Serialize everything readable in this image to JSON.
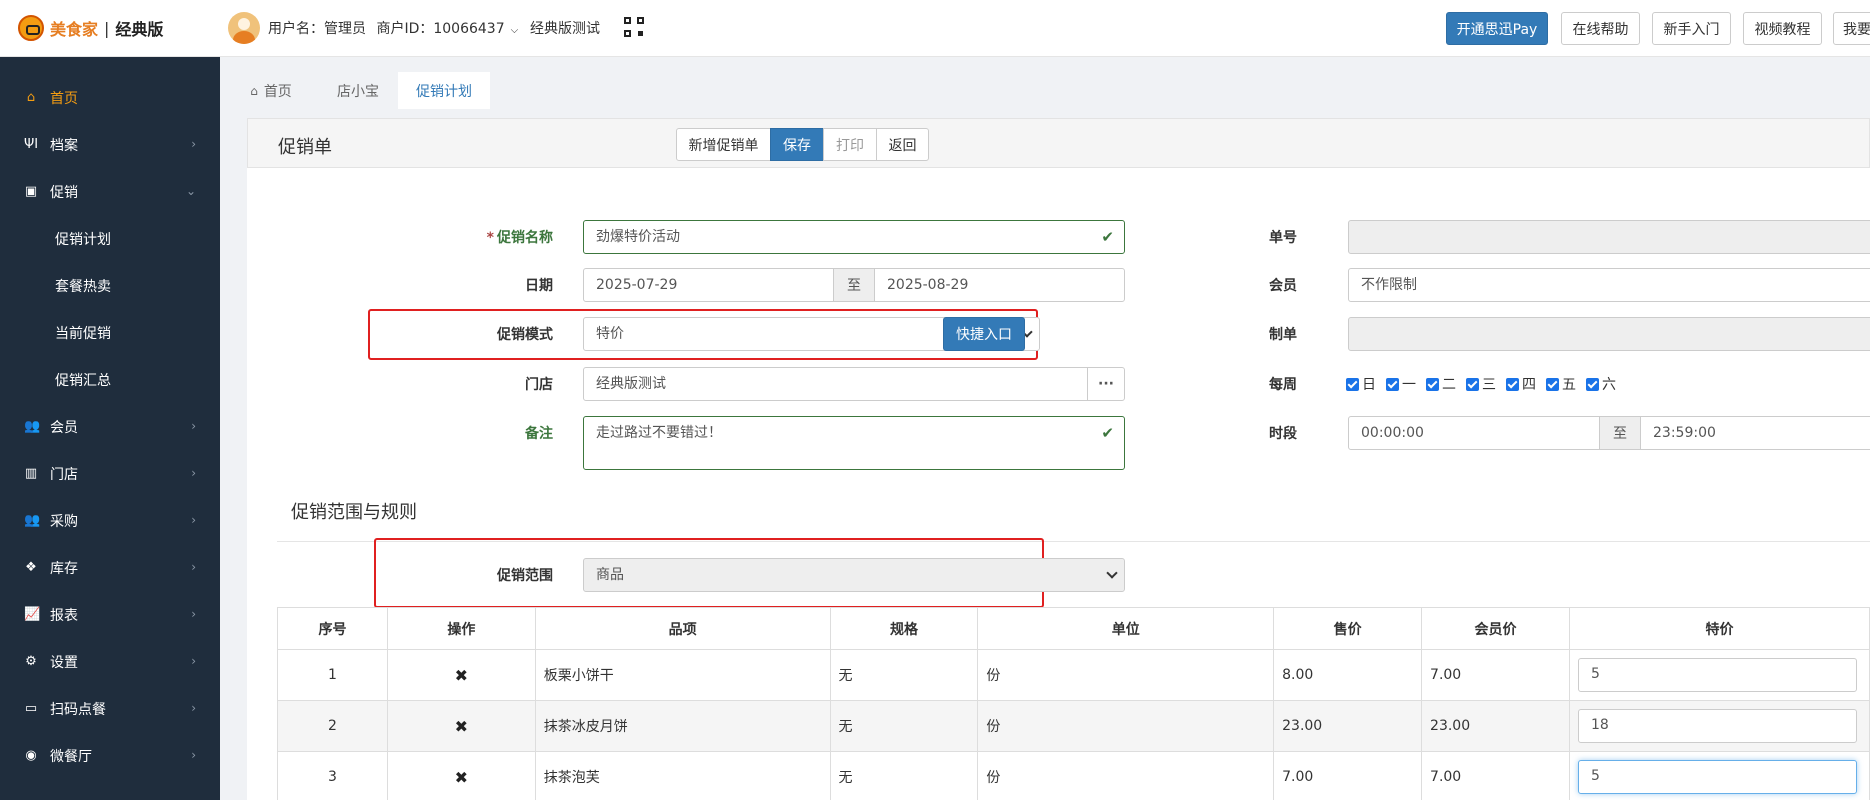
{
  "header": {
    "brand": "美食家",
    "separator": "|",
    "edition": "经典版",
    "username_label": "用户名：管理员",
    "merchant_id": "商户ID：10066437",
    "store_name": "经典版测试",
    "buttons": [
      "开通思迅Pay",
      "在线帮助",
      "新手入门",
      "视频教程",
      "我要购"
    ]
  },
  "sidebar": {
    "items": [
      {
        "label": "首页",
        "icon": "home-icon"
      },
      {
        "label": "档案",
        "icon": "utensils-icon"
      },
      {
        "label": "促销",
        "icon": "gift-icon"
      },
      {
        "label": "促销计划"
      },
      {
        "label": "套餐热卖"
      },
      {
        "label": "当前促销"
      },
      {
        "label": "促销汇总"
      },
      {
        "label": "会员",
        "icon": "users-icon"
      },
      {
        "label": "门店",
        "icon": "bank-icon"
      },
      {
        "label": "采购",
        "icon": "users-icon"
      },
      {
        "label": "库存",
        "icon": "cubes-icon"
      },
      {
        "label": "报表",
        "icon": "chart-icon"
      },
      {
        "label": "设置",
        "icon": "gear-icon"
      },
      {
        "label": "扫码点餐",
        "icon": "laptop-icon"
      },
      {
        "label": "微餐厅",
        "icon": "compass-icon"
      }
    ]
  },
  "tabs": [
    "首页",
    "店小宝",
    "促销计划"
  ],
  "panel": {
    "title": "促销单",
    "actions": [
      "新增促销单",
      "保存",
      "打印",
      "返回"
    ]
  },
  "form": {
    "name_label": "促销名称",
    "name_value": "劲爆特价活动",
    "date_label": "日期",
    "date_start": "2025-07-29",
    "date_to": "至",
    "date_end": "2025-08-29",
    "mode_label": "促销模式",
    "mode_value": "特价",
    "quick_entry": "快捷入口",
    "store_label": "门店",
    "store_value": "经典版测试",
    "store_more": "···",
    "remark_label": "备注",
    "remark_value": "走过路过不要错过！",
    "order_no_label": "单号",
    "order_no_value": "",
    "member_label": "会员",
    "member_value": "不作限制",
    "maker_label": "制单",
    "maker_value": "",
    "weekly_label": "每周",
    "weekdays": [
      "日",
      "一",
      "二",
      "三",
      "四",
      "五",
      "六"
    ],
    "time_label": "时段",
    "time_start": "00:00:00",
    "time_to": "至",
    "time_end": "23:59:00"
  },
  "scope": {
    "section_title": "促销范围与规则",
    "scope_label": "促销范围",
    "scope_value": "商品"
  },
  "table": {
    "headers": [
      "序号",
      "操作",
      "品项",
      "规格",
      "单位",
      "售价",
      "会员价",
      "特价"
    ],
    "rows": [
      {
        "no": "1",
        "action": "✖",
        "item": "板栗小饼干",
        "spec": "无",
        "unit": "份",
        "price": "8.00",
        "member_price": "7.00",
        "special": "5"
      },
      {
        "no": "2",
        "action": "✖",
        "item": "抹茶冰皮月饼",
        "spec": "无",
        "unit": "份",
        "price": "23.00",
        "member_price": "23.00",
        "special": "18"
      },
      {
        "no": "3",
        "action": "✖",
        "item": "抹茶泡芙",
        "spec": "无",
        "unit": "份",
        "price": "7.00",
        "member_price": "7.00",
        "special": "5"
      }
    ]
  },
  "colors": {
    "primary": "#337ab7",
    "sidebar_bg": "#1f2d3d",
    "active_orange": "#f39c12",
    "success_green": "#3c763d",
    "highlight_red": "#e02020"
  }
}
